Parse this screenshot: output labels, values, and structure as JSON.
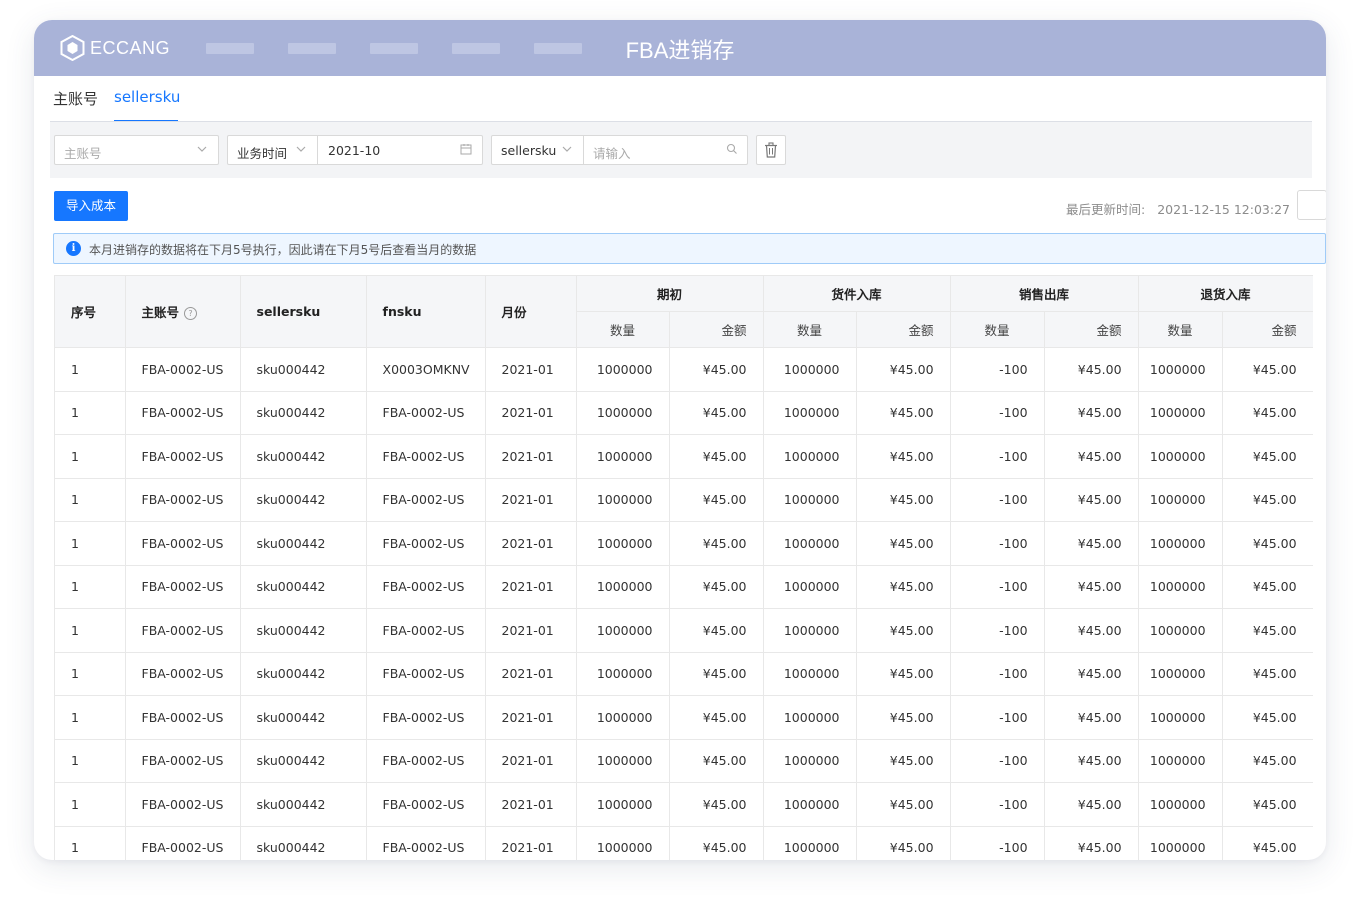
{
  "header": {
    "logo_text": "ECCANG",
    "title": "FBA进销存",
    "nav_placeholders": [
      1,
      2,
      3,
      4,
      5
    ]
  },
  "tabs": [
    {
      "label": "主账号",
      "active": false
    },
    {
      "label": "sellersku",
      "active": true
    }
  ],
  "filters": {
    "account": {
      "placeholder": "主账号"
    },
    "time_type": {
      "value": "业务时间"
    },
    "month": {
      "value": "2021-10"
    },
    "search_field": {
      "value": "sellersku"
    },
    "search": {
      "placeholder": "请输入"
    }
  },
  "toolbar": {
    "import_label": "导入成本",
    "last_update_label": "最后更新时间:",
    "last_update_value": "2021-12-15 12:03:27"
  },
  "notice": {
    "text": "本月进销存的数据将在下月5号执行，因此请在下月5号后查看当月的数据"
  },
  "table": {
    "columns": {
      "index": "序号",
      "account": "主账号",
      "sellersku": "sellersku",
      "fnsku": "fnsku",
      "month": "月份"
    },
    "groups": [
      "期初",
      "货件入库",
      "销售出库",
      "退货入库"
    ],
    "sub_columns": [
      "数量",
      "金额"
    ],
    "rows": [
      [
        "1",
        "FBA-0002-US",
        "sku000442",
        "X0003OMKNV",
        "2021-01",
        "1000000",
        "¥45.00",
        "1000000",
        "¥45.00",
        "-100",
        "¥45.00",
        "1000000",
        "¥45.00"
      ],
      [
        "1",
        "FBA-0002-US",
        "sku000442",
        "FBA-0002-US",
        "2021-01",
        "1000000",
        "¥45.00",
        "1000000",
        "¥45.00",
        "-100",
        "¥45.00",
        "1000000",
        "¥45.00"
      ],
      [
        "1",
        "FBA-0002-US",
        "sku000442",
        "FBA-0002-US",
        "2021-01",
        "1000000",
        "¥45.00",
        "1000000",
        "¥45.00",
        "-100",
        "¥45.00",
        "1000000",
        "¥45.00"
      ],
      [
        "1",
        "FBA-0002-US",
        "sku000442",
        "FBA-0002-US",
        "2021-01",
        "1000000",
        "¥45.00",
        "1000000",
        "¥45.00",
        "-100",
        "¥45.00",
        "1000000",
        "¥45.00"
      ],
      [
        "1",
        "FBA-0002-US",
        "sku000442",
        "FBA-0002-US",
        "2021-01",
        "1000000",
        "¥45.00",
        "1000000",
        "¥45.00",
        "-100",
        "¥45.00",
        "1000000",
        "¥45.00"
      ],
      [
        "1",
        "FBA-0002-US",
        "sku000442",
        "FBA-0002-US",
        "2021-01",
        "1000000",
        "¥45.00",
        "1000000",
        "¥45.00",
        "-100",
        "¥45.00",
        "1000000",
        "¥45.00"
      ],
      [
        "1",
        "FBA-0002-US",
        "sku000442",
        "FBA-0002-US",
        "2021-01",
        "1000000",
        "¥45.00",
        "1000000",
        "¥45.00",
        "-100",
        "¥45.00",
        "1000000",
        "¥45.00"
      ],
      [
        "1",
        "FBA-0002-US",
        "sku000442",
        "FBA-0002-US",
        "2021-01",
        "1000000",
        "¥45.00",
        "1000000",
        "¥45.00",
        "-100",
        "¥45.00",
        "1000000",
        "¥45.00"
      ],
      [
        "1",
        "FBA-0002-US",
        "sku000442",
        "FBA-0002-US",
        "2021-01",
        "1000000",
        "¥45.00",
        "1000000",
        "¥45.00",
        "-100",
        "¥45.00",
        "1000000",
        "¥45.00"
      ],
      [
        "1",
        "FBA-0002-US",
        "sku000442",
        "FBA-0002-US",
        "2021-01",
        "1000000",
        "¥45.00",
        "1000000",
        "¥45.00",
        "-100",
        "¥45.00",
        "1000000",
        "¥45.00"
      ],
      [
        "1",
        "FBA-0002-US",
        "sku000442",
        "FBA-0002-US",
        "2021-01",
        "1000000",
        "¥45.00",
        "1000000",
        "¥45.00",
        "-100",
        "¥45.00",
        "1000000",
        "¥45.00"
      ],
      [
        "1",
        "FBA-0002-US",
        "sku000442",
        "FBA-0002-US",
        "2021-01",
        "1000000",
        "¥45.00",
        "1000000",
        "¥45.00",
        "-100",
        "¥45.00",
        "1000000",
        "¥45.00"
      ]
    ]
  },
  "colors": {
    "topbar": "#a9b3d8",
    "accent": "#1677ff",
    "notice_bg": "#eef6ff"
  }
}
